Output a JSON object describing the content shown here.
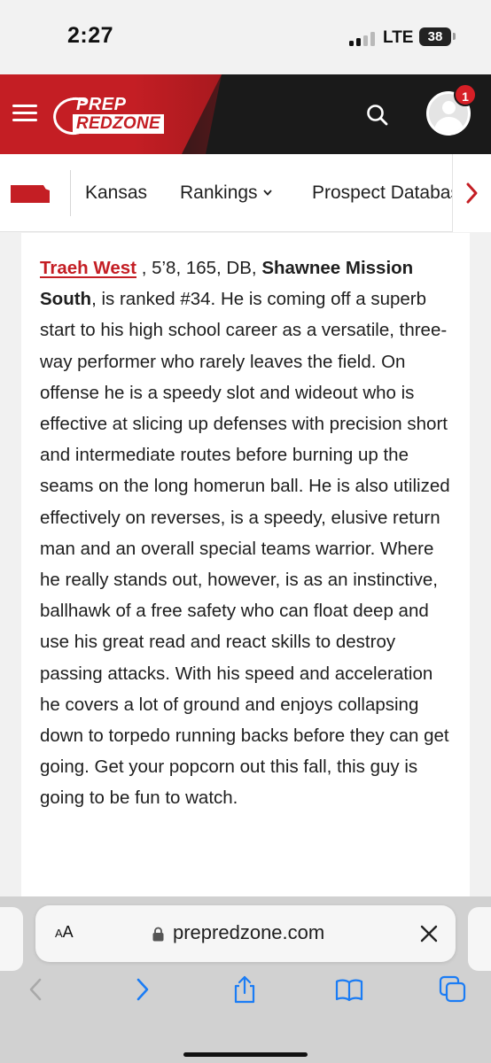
{
  "status_bar": {
    "time": "2:27",
    "network": "LTE",
    "battery": "38"
  },
  "header": {
    "logo_line1": "PREP",
    "logo_line2": "REDZONE",
    "notification_count": "1",
    "colors": {
      "brand_red": "#c41e24",
      "header_bg": "#1a1a1a"
    }
  },
  "state_nav": {
    "items": [
      {
        "label": "Kansas"
      },
      {
        "label": "Rankings",
        "icon": "chevron-down-icon"
      },
      {
        "label": "Prospect Database"
      }
    ]
  },
  "article": {
    "player_name": "Traeh West",
    "measurables": " , 5’8, 165, DB, ",
    "school": "Shawnee Mission South",
    "body": ", is ranked #34. He is coming off a superb start to his high school career as a versatile, three-way performer who rarely leaves the field. On offense he is a speedy slot and wideout who is effective at slicing up defenses with precision short and intermediate routes before burning up the seams on the long homerun ball. He is also utilized effectively on reverses, is a speedy, elusive return man and an overall special teams warrior. Where he really stands out, however, is as an instinctive, ballhawk of a free safety who can float deep and use his great read and react skills to destroy passing attacks. With his speed and acceleration he covers a lot of ground and enjoys collapsing down to torpedo running backs before they can get going. Get your popcorn out this fall, this guy is going to be fun to watch."
  },
  "browser": {
    "reader_label_big": "A",
    "reader_label_small": "A",
    "url": "prepredzone.com",
    "accent_color": "#1a7cf5"
  }
}
